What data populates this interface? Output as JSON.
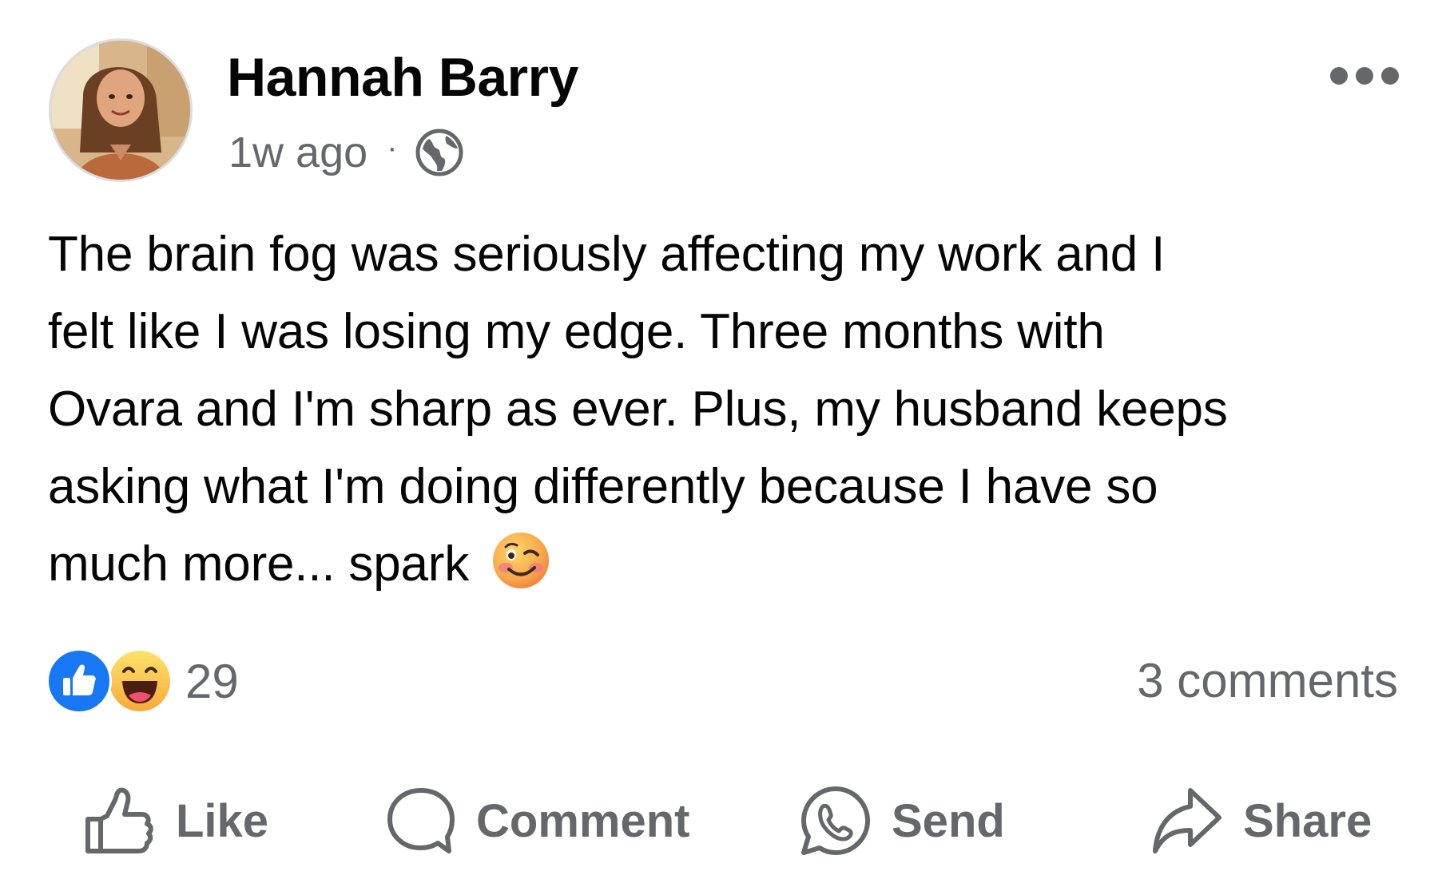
{
  "post": {
    "author": "Hannah Barry",
    "time": "1w ago",
    "separator": "·",
    "audience_icon": "globe-icon",
    "more_icon": "more-options-icon",
    "text_lines": [
      "The brain fog was seriously affecting my work and I",
      "felt like I was losing my edge. Three months with",
      "Ovara and I'm sharp as ever. Plus, my husband keeps",
      "asking what I'm doing differently because I have so",
      "much more... spark"
    ],
    "inline_emoji": "winking-face-emoji"
  },
  "engagement": {
    "reaction_icons": [
      "like-reaction-icon",
      "haha-reaction-icon"
    ],
    "reaction_count": "29",
    "comments": "3 comments"
  },
  "actions": {
    "like": "Like",
    "comment": "Comment",
    "send": "Send",
    "share": "Share"
  },
  "colors": {
    "text": "#050505",
    "secondary": "#65676b",
    "like_blue": "#1877f2",
    "background": "#ffffff"
  }
}
